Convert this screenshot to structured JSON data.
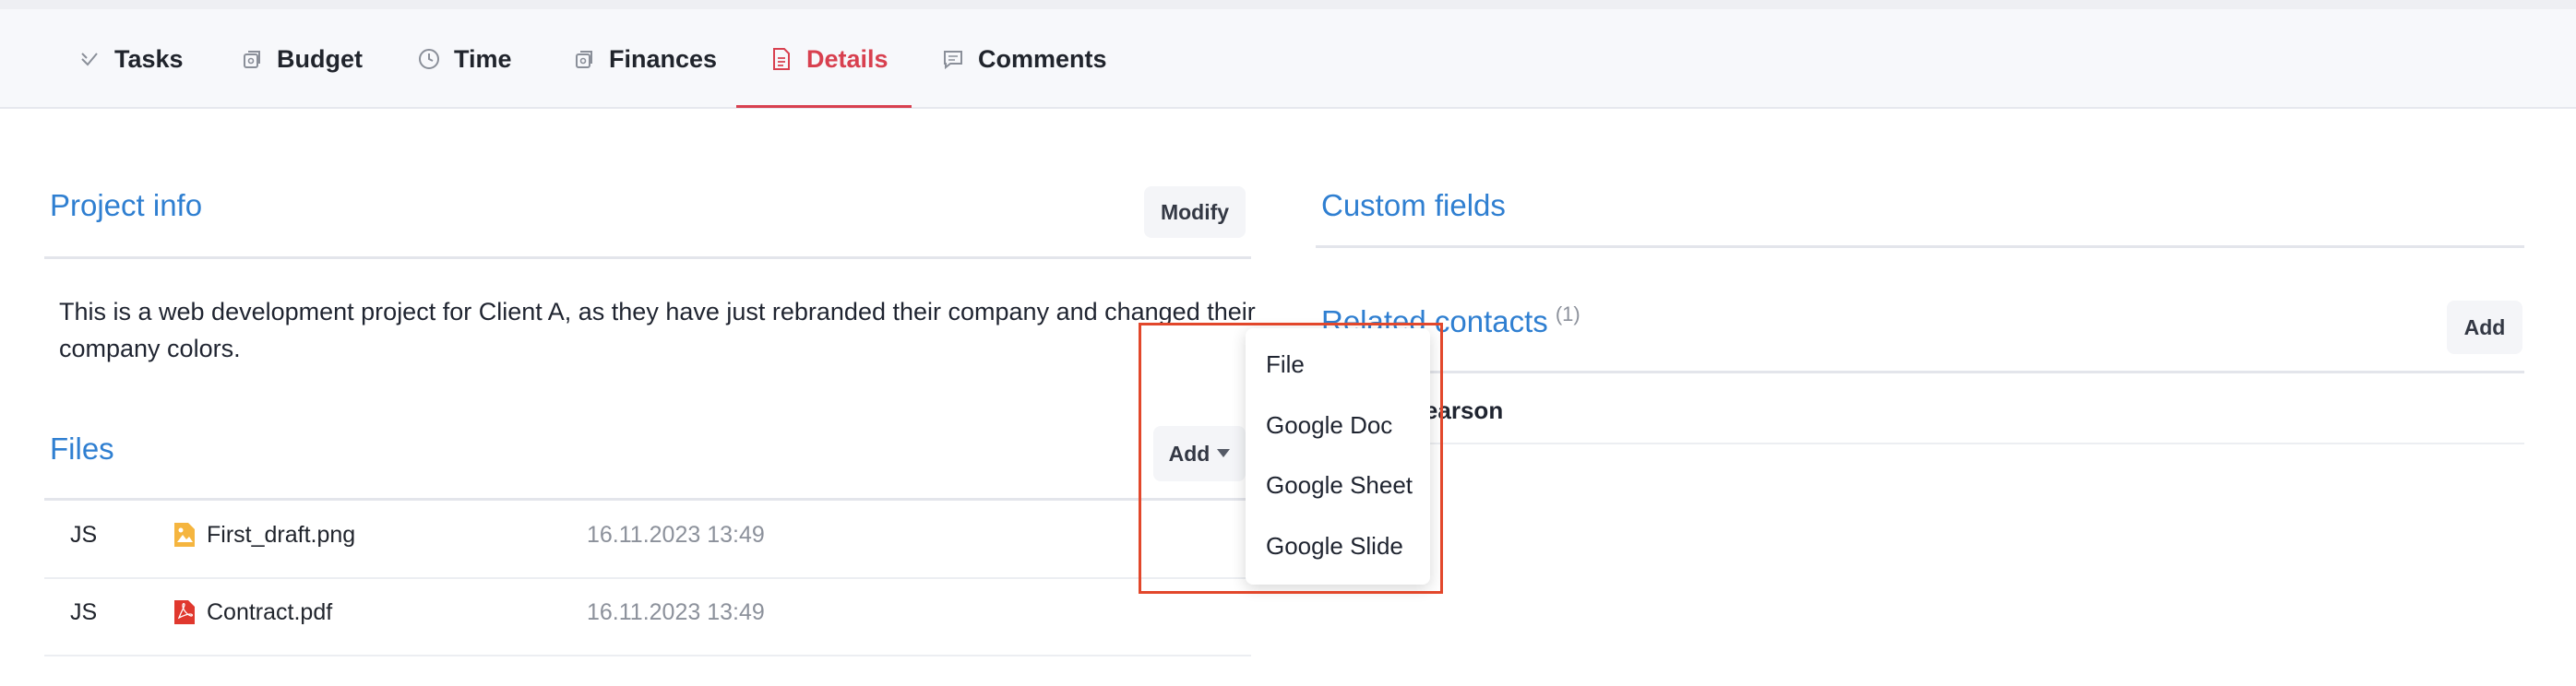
{
  "tabs": [
    {
      "label": "Tasks",
      "icon": "check-icon"
    },
    {
      "label": "Budget",
      "icon": "budget-icon"
    },
    {
      "label": "Time",
      "icon": "clock-icon"
    },
    {
      "label": "Finances",
      "icon": "finances-icon"
    },
    {
      "label": "Details",
      "icon": "document-icon",
      "active": true
    },
    {
      "label": "Comments",
      "icon": "comment-icon"
    }
  ],
  "project_info": {
    "title": "Project info",
    "modify_label": "Modify",
    "description": "This is a web development project for Client A, as they have just rebranded their company and changed their company colors."
  },
  "files": {
    "title": "Files",
    "add_label": "Add",
    "rows": [
      {
        "initials": "JS",
        "name": "First_draft.png",
        "type": "image-file-icon",
        "date": "16.11.2023 13:49"
      },
      {
        "initials": "JS",
        "name": "Contract.pdf",
        "type": "pdf-file-icon",
        "date": "16.11.2023 13:49"
      }
    ]
  },
  "custom_fields": {
    "title": "Custom fields"
  },
  "related_contacts": {
    "title": "Related contacts",
    "count": "(1)",
    "add_label": "Add",
    "contacts": [
      {
        "name": "Emily Pearson"
      }
    ]
  },
  "add_menu": {
    "items": [
      "File",
      "Google Doc",
      "Google Sheet",
      "Google Slide"
    ]
  },
  "colors": {
    "accent": "#2f7fd1",
    "active_tab": "#d8404f",
    "highlight": "#e2472b"
  }
}
